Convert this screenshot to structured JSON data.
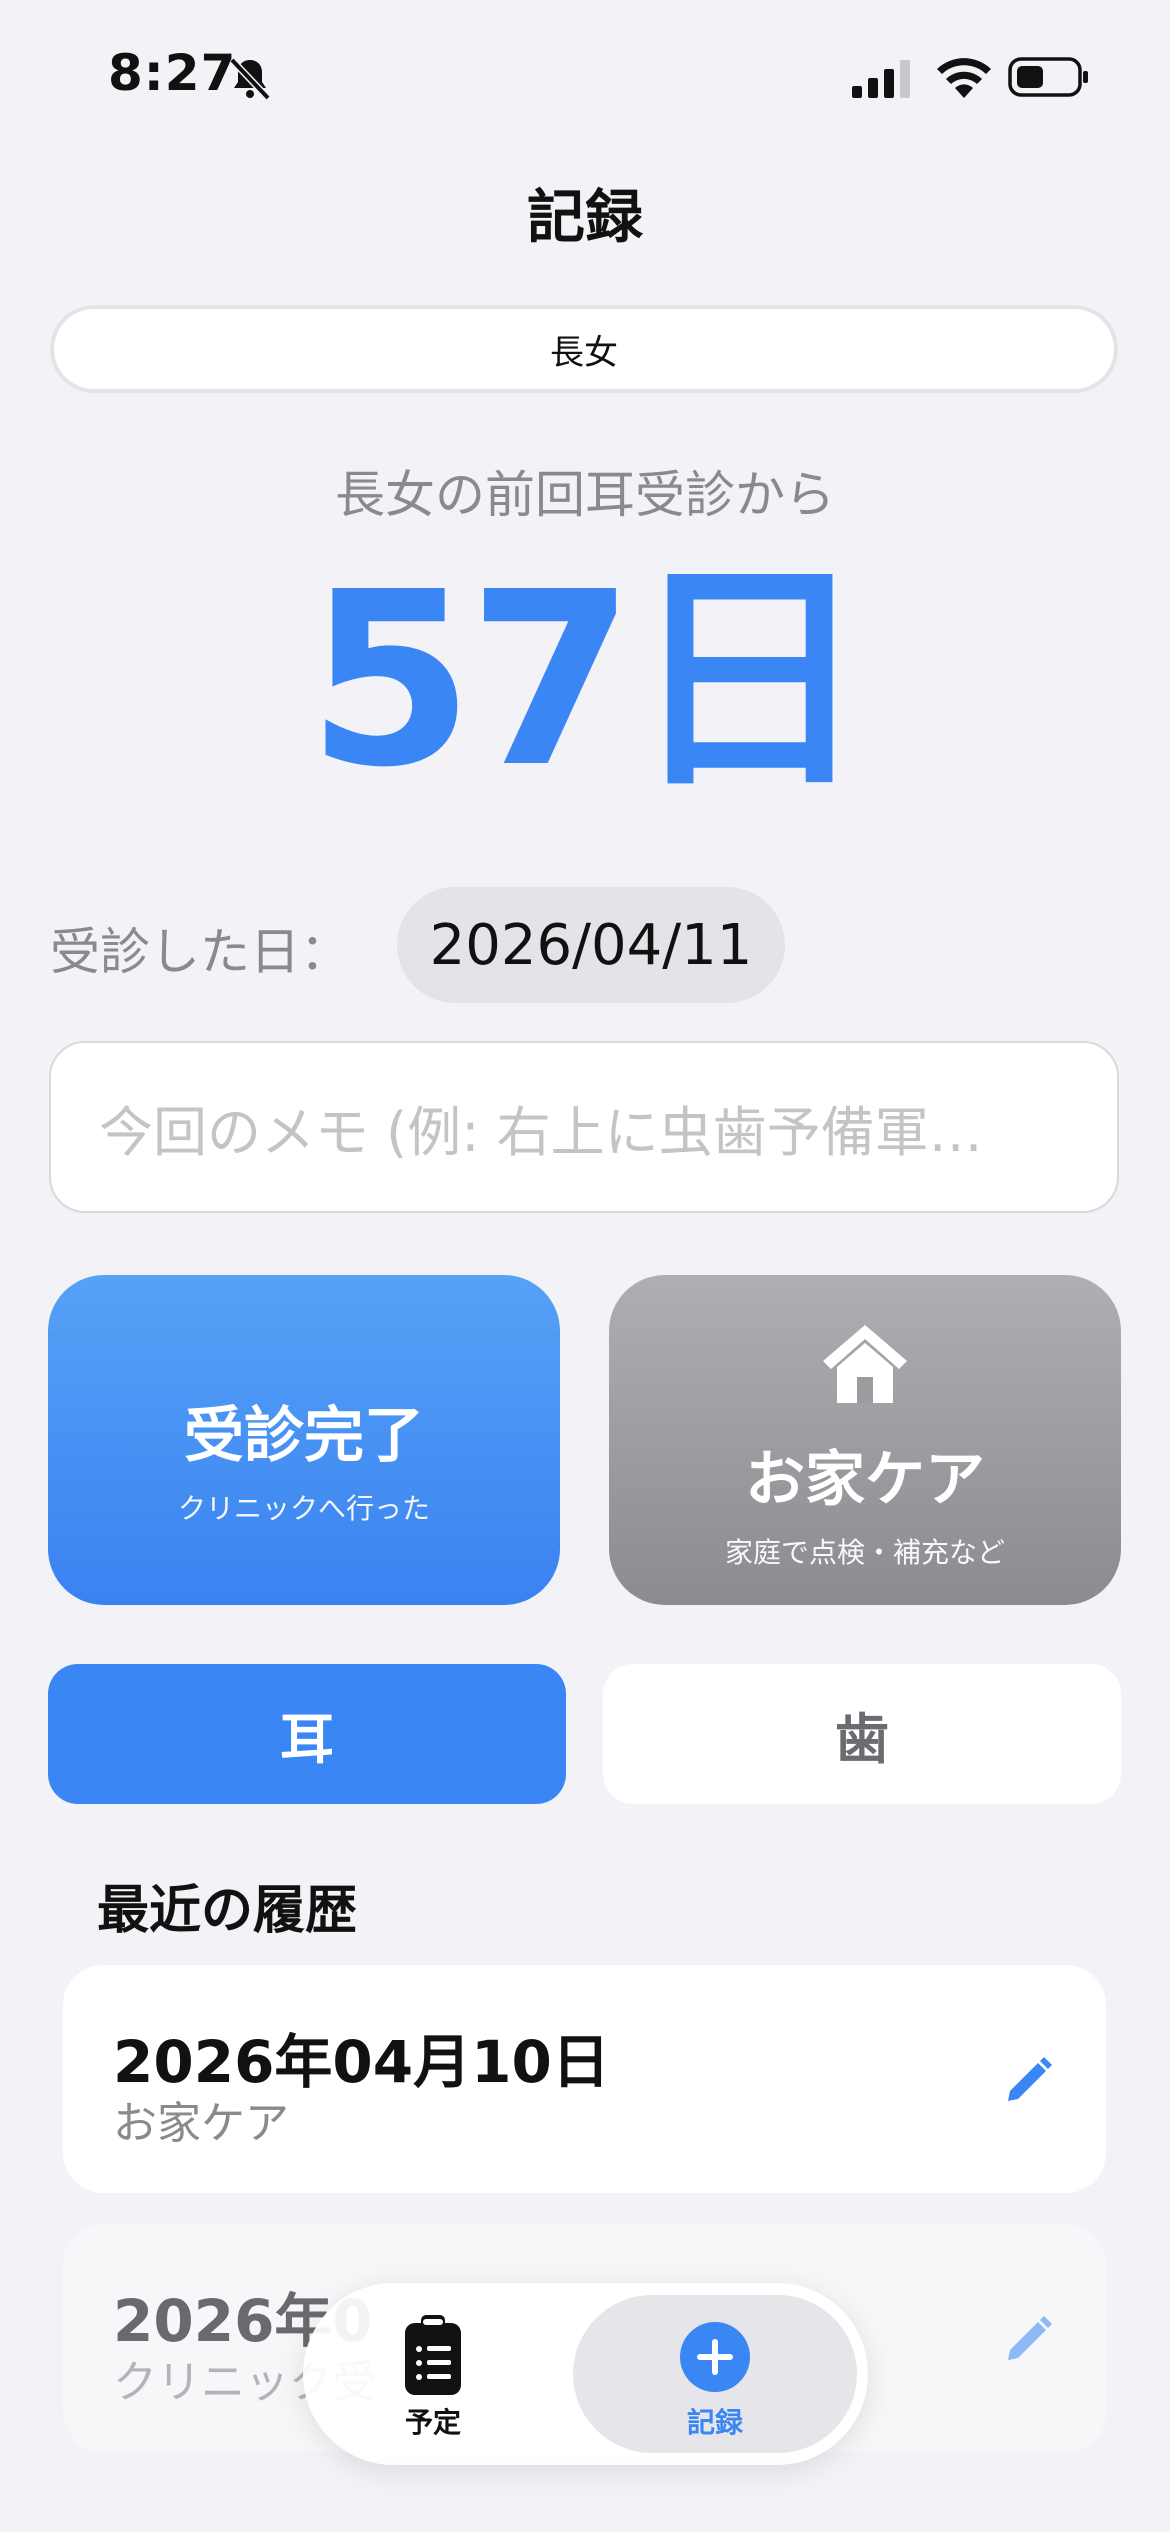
{
  "status_bar": {
    "time": "8:27"
  },
  "nav": {
    "title": "記録"
  },
  "segment": {
    "selected": "長女"
  },
  "summary": {
    "since_label": "長女の前回耳受診から",
    "days": "57日"
  },
  "visit_date": {
    "label": "受診した日：",
    "value": "2026/04/11"
  },
  "memo": {
    "placeholder": "今回のメモ (例: 右上に虫歯予備軍…"
  },
  "actions": {
    "visit": {
      "title": "受診完了",
      "subtitle": "クリニックへ行った"
    },
    "home": {
      "title": "お家ケア",
      "subtitle": "家庭で点検・補充など"
    }
  },
  "category": {
    "ear": "耳",
    "tooth": "歯",
    "selected": "耳"
  },
  "history": {
    "heading": "最近の履歴",
    "items": [
      {
        "date": "2026年04月10日",
        "type": "お家ケア"
      },
      {
        "date": "2026年0",
        "type": "クリニック受"
      }
    ]
  },
  "tabbar": {
    "schedule": "予定",
    "record": "記録",
    "selected": "記録"
  },
  "colors": {
    "accent": "#3a86f4",
    "home_card": "#8e8e93"
  }
}
